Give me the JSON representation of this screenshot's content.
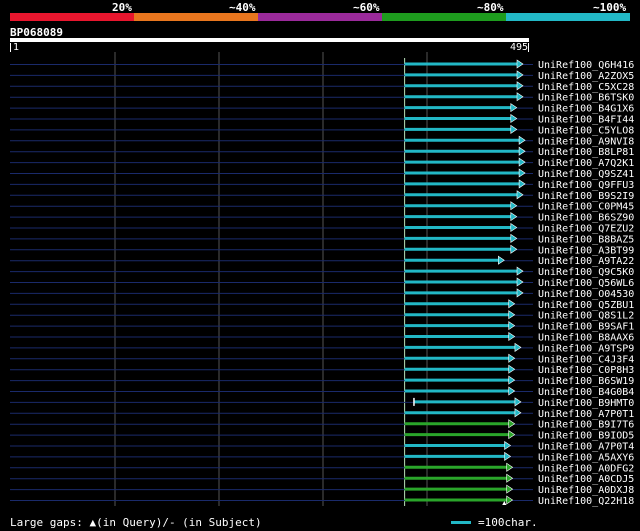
{
  "legend": {
    "segments": [
      {
        "label": "20%",
        "color": "#e8162e"
      },
      {
        "label": "~40%",
        "color": "#e8761e"
      },
      {
        "label": "~60%",
        "color": "#9b2a9b"
      },
      {
        "label": "~80%",
        "color": "#1e9c1e"
      },
      {
        "label": "~100%",
        "color": "#22b8c6"
      }
    ]
  },
  "query": {
    "name": "BP068089",
    "start": "1",
    "end": "495"
  },
  "colors": {
    "teal": "#22b8c6",
    "green": "#2aa52a",
    "gridline": "#555555",
    "track": "#1a2a6a",
    "guide": "#b9e3b9"
  },
  "hits": [
    {
      "label": "UniRef100_Q6H416",
      "start": 381,
      "end": 495,
      "color": "teal"
    },
    {
      "label": "UniRef100_A2ZOX5",
      "start": 381,
      "end": 495,
      "color": "teal"
    },
    {
      "label": "UniRef100_C5XC28",
      "start": 381,
      "end": 495,
      "color": "teal"
    },
    {
      "label": "UniRef100_B6TSK0",
      "start": 381,
      "end": 495,
      "color": "teal"
    },
    {
      "label": "UniRef100_B4G1X6",
      "start": 381,
      "end": 489,
      "color": "teal"
    },
    {
      "label": "UniRef100_B4FI44",
      "start": 381,
      "end": 489,
      "color": "teal"
    },
    {
      "label": "UniRef100_C5YLO8",
      "start": 381,
      "end": 489,
      "color": "teal"
    },
    {
      "label": "UniRef100_A9NVI8",
      "start": 381,
      "end": 497,
      "color": "teal"
    },
    {
      "label": "UniRef100_B8LP81",
      "start": 381,
      "end": 497,
      "color": "teal"
    },
    {
      "label": "UniRef100_A7Q2K1",
      "start": 381,
      "end": 497,
      "color": "teal"
    },
    {
      "label": "UniRef100_Q9SZ41",
      "start": 381,
      "end": 497,
      "color": "teal"
    },
    {
      "label": "UniRef100_Q9FFU3",
      "start": 381,
      "end": 497,
      "color": "teal"
    },
    {
      "label": "UniRef100_B9S2I9",
      "start": 381,
      "end": 495,
      "color": "teal"
    },
    {
      "label": "UniRef100_C0PM45",
      "start": 381,
      "end": 489,
      "color": "teal"
    },
    {
      "label": "UniRef100_B6SZ90",
      "start": 381,
      "end": 489,
      "color": "teal"
    },
    {
      "label": "UniRef100_Q7EZU2",
      "start": 381,
      "end": 489,
      "color": "teal"
    },
    {
      "label": "UniRef100_B8BAZ5",
      "start": 381,
      "end": 489,
      "color": "teal"
    },
    {
      "label": "UniRef100_A3BT99",
      "start": 381,
      "end": 489,
      "color": "teal"
    },
    {
      "label": "UniRef100_A9TA22",
      "start": 381,
      "end": 477,
      "color": "teal"
    },
    {
      "label": "UniRef100_Q9C5K0",
      "start": 381,
      "end": 495,
      "color": "teal"
    },
    {
      "label": "UniRef100_Q56WL6",
      "start": 381,
      "end": 495,
      "color": "teal"
    },
    {
      "label": "UniRef100_O04530",
      "start": 381,
      "end": 495,
      "color": "teal"
    },
    {
      "label": "UniRef100_Q5ZBU1",
      "start": 381,
      "end": 487,
      "color": "teal"
    },
    {
      "label": "UniRef100_Q8S1L2",
      "start": 381,
      "end": 487,
      "color": "teal"
    },
    {
      "label": "UniRef100_B9SAF1",
      "start": 381,
      "end": 487,
      "color": "teal"
    },
    {
      "label": "UniRef100_B8AAX6",
      "start": 381,
      "end": 487,
      "color": "teal"
    },
    {
      "label": "UniRef100_A9TSP9",
      "start": 381,
      "end": 493,
      "color": "teal"
    },
    {
      "label": "UniRef100_C4J3F4",
      "start": 381,
      "end": 487,
      "color": "teal"
    },
    {
      "label": "UniRef100_C0P8H3",
      "start": 381,
      "end": 487,
      "color": "teal"
    },
    {
      "label": "UniRef100_B6SW19",
      "start": 381,
      "end": 487,
      "color": "teal"
    },
    {
      "label": "UniRef100_B4G0B4",
      "start": 381,
      "end": 487,
      "color": "teal"
    },
    {
      "label": "UniRef100_B9HMT0",
      "start": 390,
      "end": 493,
      "color": "teal"
    },
    {
      "label": "UniRef100_A7P0T1",
      "start": 381,
      "end": 493,
      "color": "teal"
    },
    {
      "label": "UniRef100_B9I7T6",
      "start": 381,
      "end": 487,
      "color": "green"
    },
    {
      "label": "UniRef100_B9IOD5",
      "start": 381,
      "end": 487,
      "color": "green"
    },
    {
      "label": "UniRef100_A7P0T4",
      "start": 381,
      "end": 483,
      "color": "teal"
    },
    {
      "label": "UniRef100_A5AXY6",
      "start": 381,
      "end": 483,
      "color": "teal"
    },
    {
      "label": "UniRef100_A0DFG2",
      "start": 381,
      "end": 485,
      "color": "green"
    },
    {
      "label": "UniRef100_A0CDJ5",
      "start": 381,
      "end": 485,
      "color": "green"
    },
    {
      "label": "UniRef100_A0DXJ8",
      "start": 381,
      "end": 485,
      "color": "green"
    },
    {
      "label": "UniRef100_Q22H18",
      "start": 381,
      "end": 485,
      "color": "green"
    }
  ],
  "footer": {
    "gaps_text": "Large gaps: ▲(in Query)/- (in Subject)",
    "scale_text": "=100char."
  }
}
